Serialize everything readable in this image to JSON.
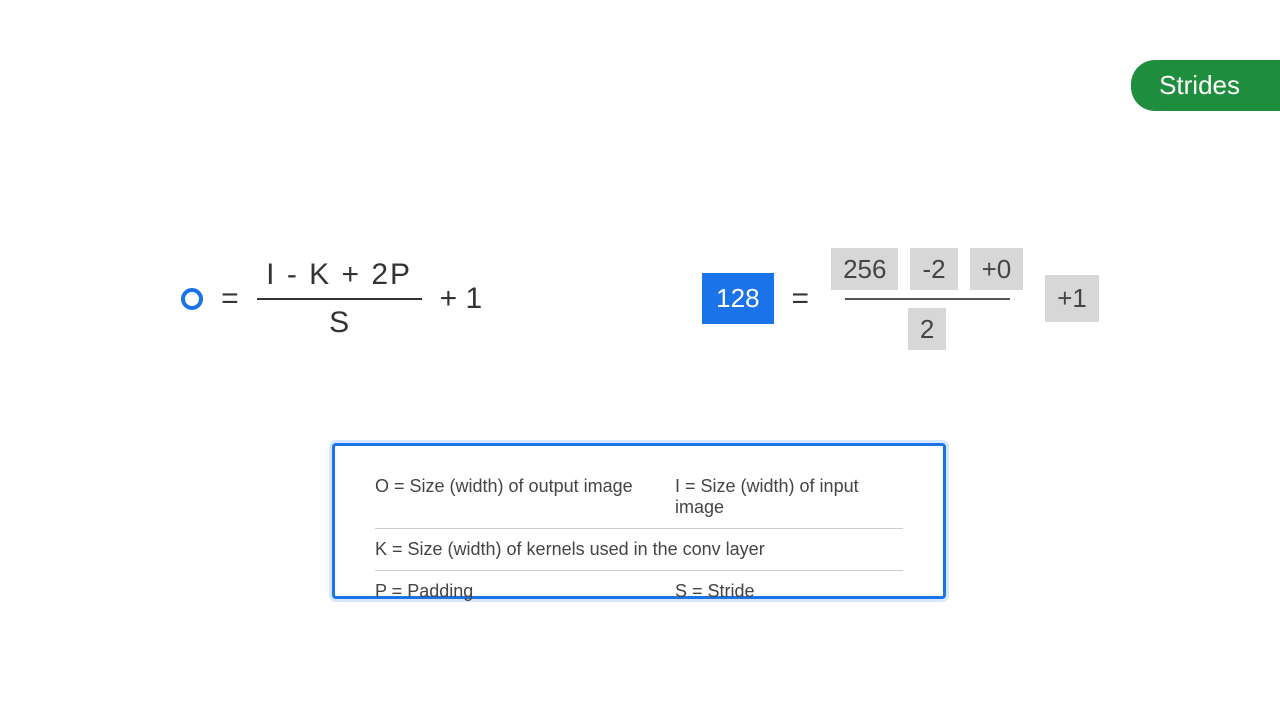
{
  "pill": "Strides",
  "formula": {
    "O": "O",
    "eq": "=",
    "numer": "I  -  K  +  2P",
    "denom": "S",
    "plus1": "+  1"
  },
  "example": {
    "result": "128",
    "eq": "=",
    "n1": "256",
    "n2": "-2",
    "n3": "+0",
    "denom": "2",
    "plus1": "+1"
  },
  "legend": {
    "O": "O = Size (width) of output image",
    "I": "I = Size (width) of input image",
    "K": "K = Size (width) of kernels used in the conv layer",
    "P": "P = Padding",
    "S": "S = Stride"
  }
}
